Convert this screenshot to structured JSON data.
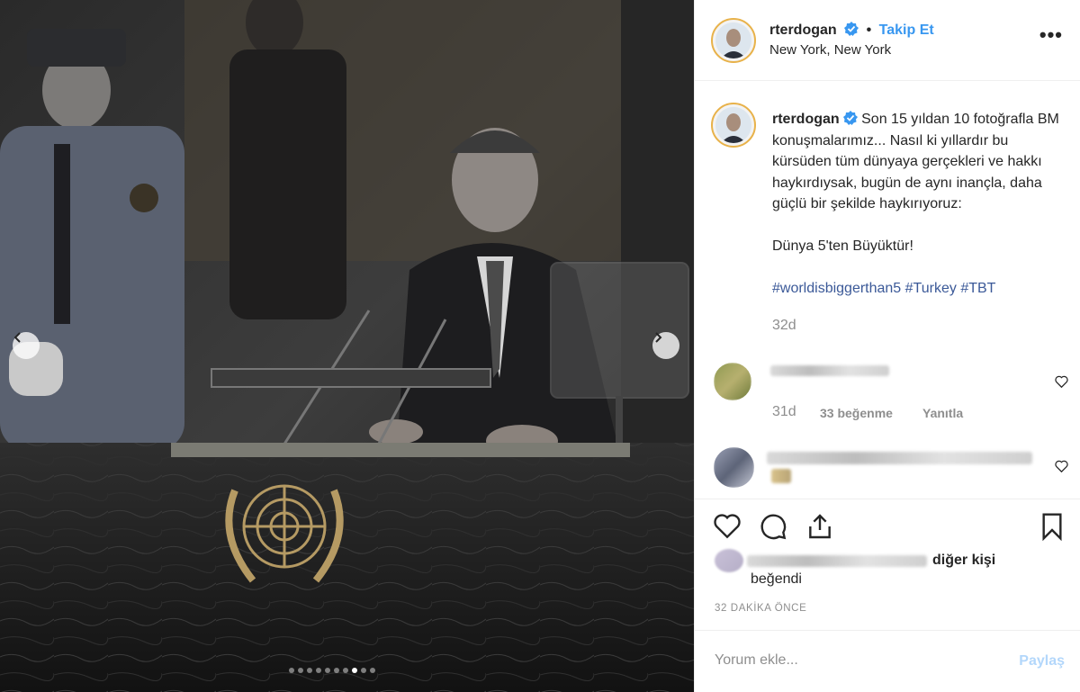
{
  "post": {
    "username": "rterdogan",
    "follow_label": "Takip Et",
    "separator": "•",
    "location": "New York, New York",
    "more_label": "•••",
    "caption": {
      "username": "rterdogan",
      "text": "Son 15 yıldan 10 fotoğrafla BM konuşmalarımız... Nasıl ki yıllardır bu kürsüden tüm dünyaya gerçekleri ve hakkı haykırdıysak, bugün de aynı inançla, daha güçlü bir şekilde haykırıyoruz:",
      "line2": "Dünya 5'ten Büyüktür!",
      "hashtags": [
        "#worldisbiggerthan5",
        "#Turkey",
        "#TBT"
      ],
      "age": "32d"
    },
    "comments": [
      {
        "age": "31d",
        "likes": "33 beğenme",
        "reply": "Yanıtla"
      }
    ],
    "likes_suffix": "diğer kişi",
    "likes_line2": "beğendi",
    "time_ago": "32 DAKİKA ÖNCE",
    "comment_placeholder": "Yorum ekle...",
    "share_label": "Paylaş"
  },
  "carousel": {
    "total": 10,
    "active_index": 7
  },
  "colors": {
    "link": "#3897f0",
    "hashtag": "#3b5998",
    "muted": "#8e8e8e",
    "share_disabled": "#b3d7fb",
    "avatar_ring": "#e8b24a"
  },
  "icons": [
    "verified-icon",
    "heart-icon",
    "comment-icon",
    "share-icon",
    "bookmark-icon",
    "chevron-left-icon",
    "chevron-right-icon"
  ]
}
